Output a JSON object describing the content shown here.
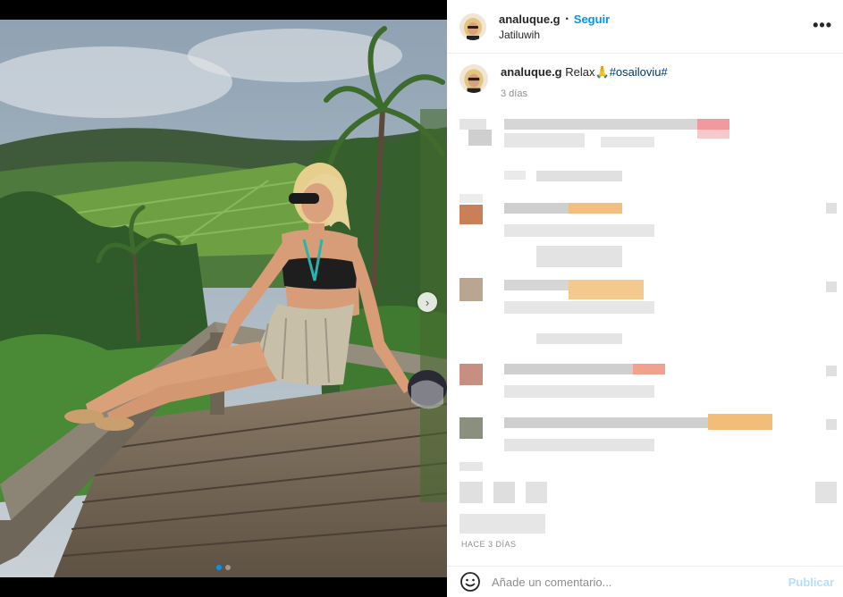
{
  "post": {
    "username": "analuque.g",
    "separator": "•",
    "follow_label": "Seguir",
    "location": "Jatiluwih",
    "more_icon": "more-horizontal-icon",
    "caption_username": "analuque.g",
    "caption_text": "Relax",
    "caption_emoji": "🙏",
    "caption_hashtag": "#osailoviu#",
    "caption_time": "3 días",
    "post_time": "HACE 3 DÍAS",
    "carousel_dots": 2,
    "carousel_active": 0
  },
  "composer": {
    "placeholder": "Añade un comentario...",
    "publish_label": "Publicar",
    "emoji_icon": "smiley-icon"
  },
  "colors": {
    "accent": "#0095f6",
    "publish_disabled": "#b2dffc",
    "hashtag": "#00376b"
  }
}
